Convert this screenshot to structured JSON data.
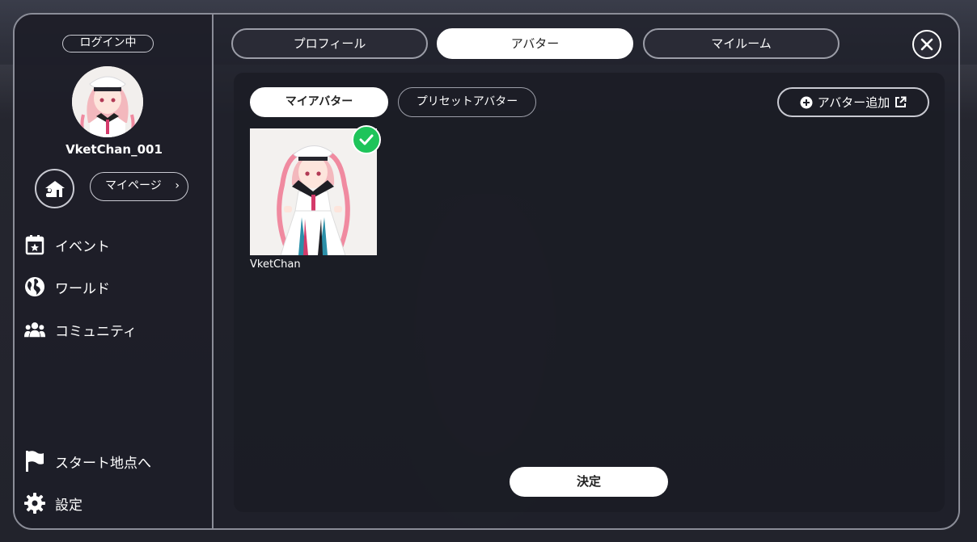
{
  "sidebar": {
    "login_status": "ログイン中",
    "username": "VketChan_001",
    "mypage_label": "マイページ",
    "nav": [
      {
        "label": "イベント",
        "icon": "calendar-star-icon"
      },
      {
        "label": "ワールド",
        "icon": "globe-icon"
      },
      {
        "label": "コミュニティ",
        "icon": "people-icon"
      }
    ],
    "bottom": [
      {
        "label": "スタート地点へ",
        "icon": "flag-icon"
      },
      {
        "label": "設定",
        "icon": "gear-icon"
      }
    ]
  },
  "tabs": [
    {
      "label": "プロフィール",
      "active": false
    },
    {
      "label": "アバター",
      "active": true
    },
    {
      "label": "マイルーム",
      "active": false
    }
  ],
  "subtabs": [
    {
      "label": "マイアバター",
      "active": true
    },
    {
      "label": "プリセットアバター",
      "active": false
    }
  ],
  "add_avatar_label": "アバター追加",
  "avatars": [
    {
      "name": "VketChan",
      "selected": true
    }
  ],
  "confirm_label": "決定",
  "colors": {
    "accent_check": "#1ec45a",
    "frame_border": "#8b8d98",
    "active_tab_bg": "#ffffff"
  }
}
